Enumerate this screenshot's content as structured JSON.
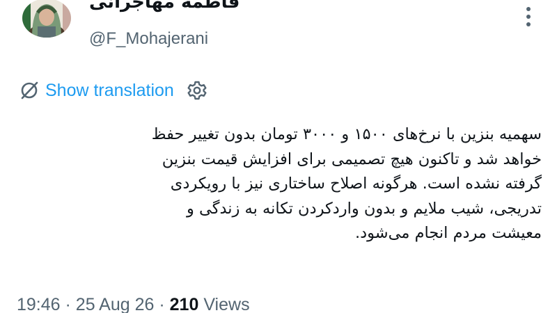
{
  "author": {
    "display_name": "فاطمه مهاجرانی",
    "handle": "@F_Mohajerani",
    "avatar_icon": "profile-photo"
  },
  "translation": {
    "label": "Show translation",
    "icon": "no-translate-icon",
    "settings_icon": "gear-icon"
  },
  "tweet": {
    "lines": [
      "سهمیه بنزین با نرخ‌های ۱۵۰۰ و ۳۰۰۰ تومان بدون تغییر حفظ",
      "خواهد شد و تاکنون هیچ تصمیمی برای افزایش قیمت بنزین",
      "گرفته نشده است. هرگونه اصلاح ساختاری نیز با رویکردی",
      "تدریجی، شیب ملایم و بدون واردکردن تکانه به زندگی و",
      "معیشت مردم انجام می‌شود."
    ]
  },
  "meta": {
    "time": "19:46",
    "date": "25 Aug 26",
    "views_count": "210",
    "views_label": "Views",
    "separator": "·"
  },
  "colors": {
    "link": "#1d9bf0",
    "secondary": "#536471",
    "text": "#0f1419"
  }
}
